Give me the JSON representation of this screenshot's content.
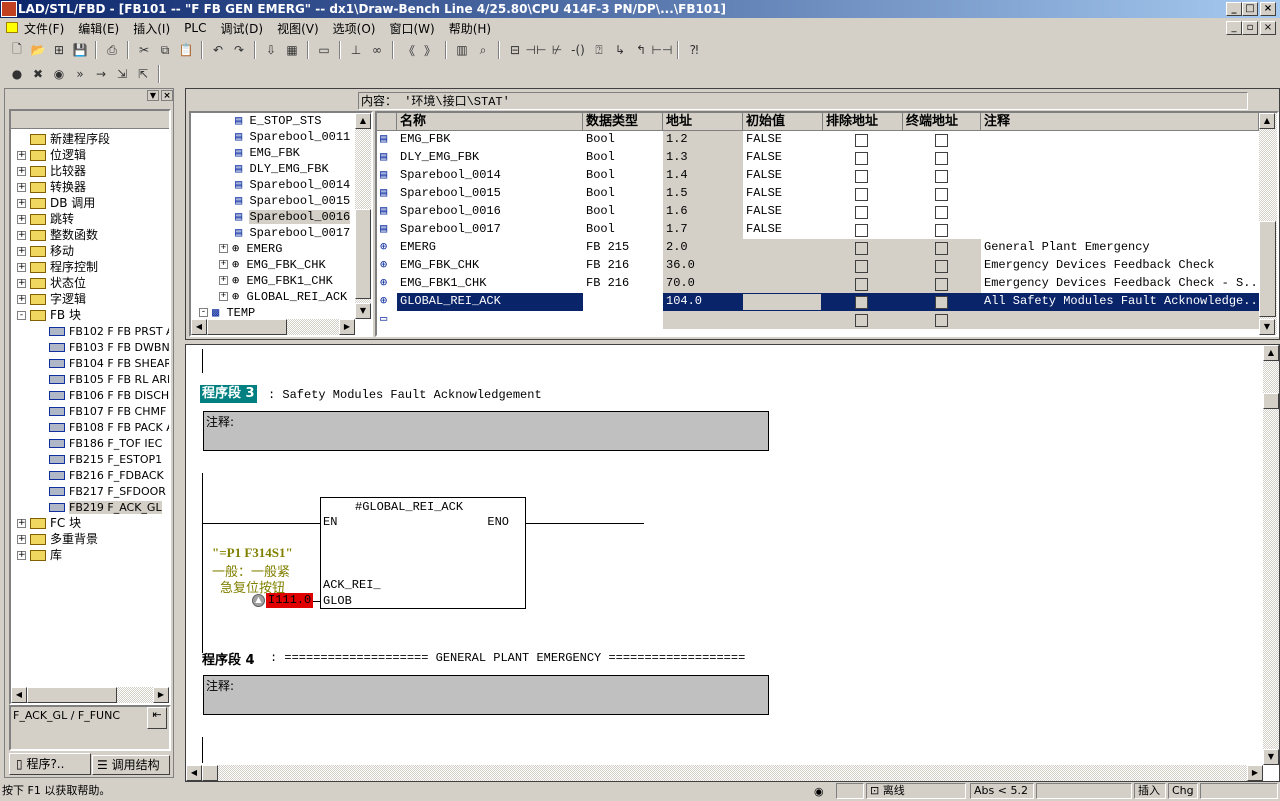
{
  "title": "LAD/STL/FBD  - [FB101 -- \"F FB GEN EMERG\" -- dx1\\Draw-Bench Line 4/25.80\\CPU 414F-3 PN/DP\\...\\FB101]",
  "menu": [
    "文件(F)",
    "编辑(E)",
    "插入(I)",
    "PLC",
    "调试(D)",
    "视图(V)",
    "选项(O)",
    "窗口(W)",
    "帮助(H)"
  ],
  "toolbar1": [
    "new-icon",
    "open-icon",
    "accessible-nodes-icon",
    "save-icon",
    "print-icon",
    "cut-icon",
    "copy-icon",
    "paste-icon",
    "undo-icon",
    "redo-icon",
    "download-icon",
    "monitor-icon",
    "overview-icon",
    "network-icon",
    "glasses-icon",
    "prev-network-icon",
    "next-network-icon",
    "catalog-icon",
    "zoom-icon",
    "new-network-icon",
    "no-contact-icon",
    "nc-contact-icon",
    "coil-icon",
    "box-icon",
    "branch-open-icon",
    "branch-close-icon",
    "connection-icon",
    "help-icon"
  ],
  "toolbar2": [
    "breakpoint-icon",
    "clear-breakpoint-icon",
    "breakpoint-active-icon",
    "next-statement-icon",
    "continue-icon",
    "call-icon",
    "jump-icon"
  ],
  "left_tree": {
    "items": [
      {
        "label": "新建程序段",
        "exp": ""
      },
      {
        "label": "位逻辑",
        "exp": "+"
      },
      {
        "label": "比较器",
        "exp": "+"
      },
      {
        "label": "转换器",
        "exp": "+"
      },
      {
        "label": "DB 调用",
        "exp": "+"
      },
      {
        "label": "跳转",
        "exp": "+"
      },
      {
        "label": "整数函数",
        "exp": "+"
      },
      {
        "label": "移动",
        "exp": "+"
      },
      {
        "label": "程序控制",
        "exp": "+"
      },
      {
        "label": "状态位",
        "exp": "+"
      },
      {
        "label": "字逻辑",
        "exp": "+"
      },
      {
        "label": "FB 块",
        "exp": "-"
      }
    ],
    "fb_items": [
      "FB102   F FB PRST A",
      "FB103   F FB DWBN",
      "FB104   F FB SHEAR",
      "FB105   F FB RL ARE",
      "FB106   F FB DISCH",
      "FB107   F FB CHMF",
      "FB108   F FB PACK A",
      "FB186   F_TOF   IEC",
      "FB215   F_ESTOP1",
      "FB216   F_FDBACK",
      "FB217   F_SFDOOR",
      "FB219   F_ACK_GL"
    ],
    "after": [
      {
        "label": "FC 块",
        "exp": "+"
      },
      {
        "label": "多重背景",
        "exp": "+"
      },
      {
        "label": "库",
        "exp": "+"
      }
    ],
    "selected": "FB219   F_ACK_GL",
    "info": "F_ACK_GL / F_FUNC",
    "tabs": [
      "程序?..",
      "调用结构"
    ]
  },
  "interface": {
    "content_label": "内容：  '环境\\接口\\STAT'",
    "tree": [
      "E_STOP_STS",
      "Sparebool_0011",
      "EMG_FBK",
      "DLY_EMG_FBK",
      "Sparebool_0014",
      "Sparebool_0015",
      "Sparebool_0016",
      "Sparebool_0017"
    ],
    "tree_fb": [
      "EMERG",
      "EMG_FBK_CHK",
      "EMG_FBK1_CHK",
      "GLOBAL_REI_ACK"
    ],
    "tree_temp": "TEMP",
    "tree_selected": "Sparebool_0016",
    "columns": [
      "名称",
      "数据类型",
      "地址",
      "初始值",
      "排除地址",
      "终端地址",
      "注释"
    ],
    "rows": [
      {
        "name": "EMG_FBK",
        "type": "Bool",
        "addr": "1.2",
        "init": "FALSE",
        "comment": "",
        "kind": "var"
      },
      {
        "name": "DLY_EMG_FBK",
        "type": "Bool",
        "addr": "1.3",
        "init": "FALSE",
        "comment": "",
        "kind": "var"
      },
      {
        "name": "Sparebool_0014",
        "type": "Bool",
        "addr": "1.4",
        "init": "FALSE",
        "comment": "",
        "kind": "var"
      },
      {
        "name": "Sparebool_0015",
        "type": "Bool",
        "addr": "1.5",
        "init": "FALSE",
        "comment": "",
        "kind": "var"
      },
      {
        "name": "Sparebool_0016",
        "type": "Bool",
        "addr": "1.6",
        "init": "FALSE",
        "comment": "",
        "kind": "var"
      },
      {
        "name": "Sparebool_0017",
        "type": "Bool",
        "addr": "1.7",
        "init": "FALSE",
        "comment": "",
        "kind": "var"
      },
      {
        "name": "EMERG",
        "type": "FB 215",
        "addr": "2.0",
        "init": "",
        "comment": "General Plant Emergency",
        "kind": "fb"
      },
      {
        "name": "EMG_FBK_CHK",
        "type": "FB 216",
        "addr": "36.0",
        "init": "",
        "comment": "Emergency Devices Feedback Check",
        "kind": "fb"
      },
      {
        "name": "EMG_FBK1_CHK",
        "type": "FB 216",
        "addr": "70.0",
        "init": "",
        "comment": "Emergency Devices Feedback Check - S...",
        "kind": "fb"
      },
      {
        "name": "GLOBAL_REI_ACK",
        "type": "FB 219",
        "addr": "104.0",
        "init": "",
        "comment": "All Safety Modules Fault Acknowledge...",
        "kind": "fb"
      },
      {
        "name": "",
        "type": "",
        "addr": "",
        "init": "",
        "comment": "",
        "kind": "new"
      }
    ],
    "selected_row": "GLOBAL_REI_ACK"
  },
  "code": {
    "net3": {
      "label": "程序段 3",
      "title": ": Safety Modules Fault Acknowledgement",
      "comment_label": "注释:"
    },
    "block": {
      "name": "#GLOBAL_REI_ACK",
      "en": "EN",
      "eno": "ENO",
      "pin1": "ACK_REI_",
      "pin2": "GLOB"
    },
    "symbol": "\"=P1 F314S1\"",
    "symbol_comment1": "一般：一般紧",
    "symbol_comment2": "急复位按钮",
    "address": "I111.0",
    "net4": {
      "label": "程序段 4",
      "title": ": ==================== GENERAL PLANT EMERGENCY ===================",
      "comment_label": "注释:"
    }
  },
  "status": {
    "help": "按下 F1 以获取帮助。",
    "mode": "离线",
    "abs": "Abs < 5.2",
    "insert": "插入",
    "chg": "Chg"
  },
  "colors": {
    "selection": "#0a246a",
    "title_start": "#0a246a",
    "network_highlight": "#008080",
    "address_bg": "#e00000",
    "symbol_text": "#808000",
    "comment_box": "#c0c0c0"
  }
}
